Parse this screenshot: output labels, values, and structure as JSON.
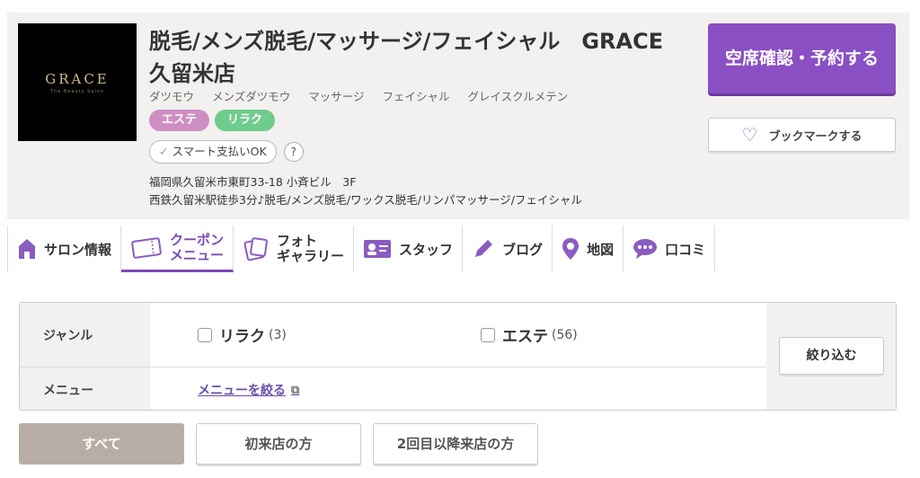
{
  "salon": {
    "logo_text": "GRACE",
    "logo_sub": "The Beauty Salon",
    "title": "脱毛/メンズ脱毛/マッサージ/フェイシャル　GRACE　久留米店",
    "kana": [
      "ダツモウ",
      "メンズダツモウ",
      "マッサージ",
      "フェイシャル",
      "グレイスクルメテン"
    ],
    "tags": [
      "エステ",
      "リラク"
    ],
    "smart_pay": "スマート支払いOK",
    "help": "?",
    "address": "福岡県久留米市東町33-18 小斉ビル　3F",
    "access": "西鉄久留米駅徒歩3分♪脱毛/メンズ脱毛/ワックス脱毛/リンパマッサージ/フェイシャル"
  },
  "actions": {
    "reserve": "空席確認・予約する",
    "bookmark": "ブックマークする"
  },
  "nav": {
    "items": [
      {
        "label": "サロン情報",
        "icon": "home-icon"
      },
      {
        "label": "クーポン\nメニュー",
        "icon": "ticket-icon",
        "active": true
      },
      {
        "label": "フォト\nギャラリー",
        "icon": "photo-icon"
      },
      {
        "label": "スタッフ",
        "icon": "staff-card-icon"
      },
      {
        "label": "ブログ",
        "icon": "pencil-icon"
      },
      {
        "label": "地図",
        "icon": "map-pin-icon"
      },
      {
        "label": "口コミ",
        "icon": "chat-icon"
      }
    ]
  },
  "filter": {
    "genre_label": "ジャンル",
    "options": [
      {
        "label": "リラク",
        "count": "(3)"
      },
      {
        "label": "エステ",
        "count": "(56)"
      }
    ],
    "menu_label": "メニュー",
    "menu_link": "メニューを絞る",
    "narrow_button": "絞り込む"
  },
  "customer_tabs": [
    "すべて",
    "初来店の方",
    "2回目以降来店の方"
  ],
  "colors": {
    "accent": "#8a4fc3",
    "tag_este": "#cf8ec3",
    "tag_rirak": "#6fcc8c",
    "active_tab": "#b8ada5"
  }
}
